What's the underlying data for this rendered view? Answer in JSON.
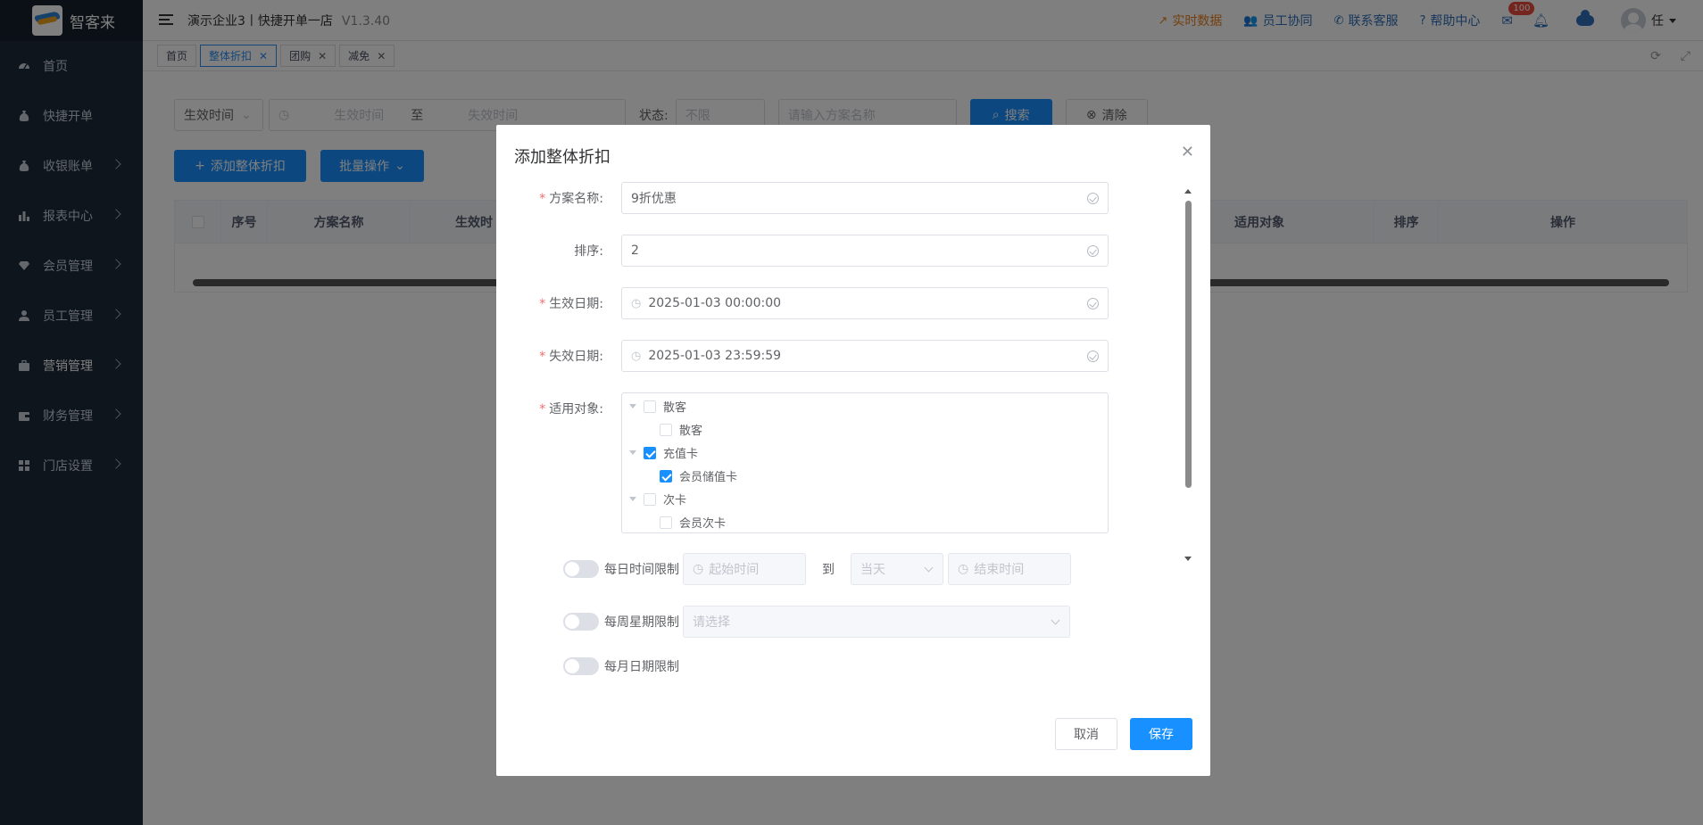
{
  "brand": {
    "name": "智客来"
  },
  "sidebar": {
    "items": [
      {
        "label": "首页",
        "icon": "dashboard-icon"
      },
      {
        "label": "快捷开单",
        "icon": "moneybag-icon"
      },
      {
        "label": "收银账单",
        "icon": "moneybag-icon"
      },
      {
        "label": "报表中心",
        "icon": "bar-chart-icon"
      },
      {
        "label": "会员管理",
        "icon": "diamond-icon"
      },
      {
        "label": "员工管理",
        "icon": "user-icon"
      },
      {
        "label": "营销管理",
        "icon": "briefcase-icon"
      },
      {
        "label": "财务管理",
        "icon": "wallet-icon"
      },
      {
        "label": "门店设置",
        "icon": "grid-icon"
      }
    ]
  },
  "header": {
    "crumb": "演示企业3丨快捷开单一店",
    "version": "V1.3.40",
    "links": {
      "realtime": "实时数据",
      "staff": "员工协同",
      "service": "联系客服",
      "help": "帮助中心"
    },
    "mail_badge": "100",
    "user": "任"
  },
  "tabs": [
    {
      "label": "首页"
    },
    {
      "label": "整体折扣"
    },
    {
      "label": "团购"
    },
    {
      "label": "减免"
    }
  ],
  "filters": {
    "date_type": "生效时间",
    "start_placeholder": "生效时间",
    "range_sep": "至",
    "end_placeholder": "失效时间",
    "status_label": "状态:",
    "status_value": "不限",
    "name_placeholder": "请输入方案名称",
    "search_label": "搜索",
    "clear_label": "清除",
    "add_label": "添加整体折扣",
    "batch_label": "批量操作"
  },
  "table": {
    "columns": [
      "序号",
      "方案名称",
      "生效时",
      "适用对象",
      "排序",
      "操作"
    ]
  },
  "dialog": {
    "title": "添加整体折扣",
    "fields": {
      "name": {
        "label": "方案名称:",
        "value": "9折优惠"
      },
      "sort": {
        "label": "排序:",
        "value": "2"
      },
      "start": {
        "label": "生效日期:",
        "value": "2025-01-03 00:00:00"
      },
      "end": {
        "label": "失效日期:",
        "value": "2025-01-03 23:59:59"
      },
      "target": {
        "label": "适用对象:"
      }
    },
    "tree": [
      {
        "label": "散客",
        "level": 0,
        "checked": false
      },
      {
        "label": "散客",
        "level": 1,
        "checked": false
      },
      {
        "label": "充值卡",
        "level": 0,
        "checked": true
      },
      {
        "label": "会员储值卡",
        "level": 1,
        "checked": true
      },
      {
        "label": "次卡",
        "level": 0,
        "checked": false
      },
      {
        "label": "会员次卡",
        "level": 1,
        "checked": false
      }
    ],
    "daily": {
      "label": "每日时间限制",
      "start_placeholder": "起始时间",
      "to": "到",
      "day": "当天",
      "end_placeholder": "结束时间"
    },
    "weekly": {
      "label": "每周星期限制",
      "placeholder": "请选择"
    },
    "monthly": {
      "label": "每月日期限制"
    },
    "cancel_label": "取消",
    "save_label": "保存"
  }
}
